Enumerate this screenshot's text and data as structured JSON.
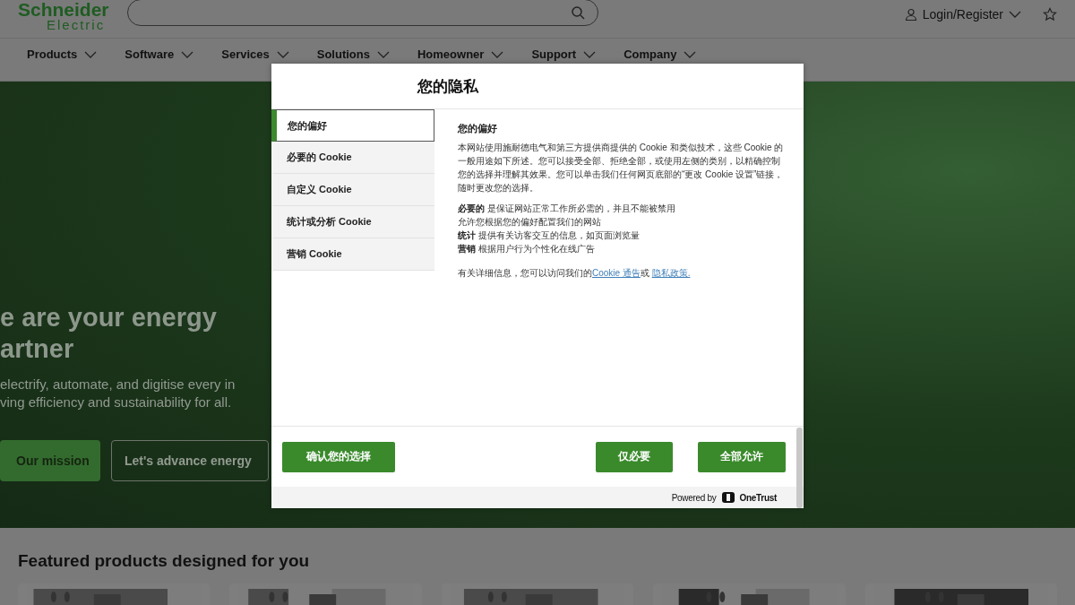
{
  "header": {
    "logo": {
      "line_1": "Schneider",
      "line_2": "Electric"
    },
    "login": "Login/Register"
  },
  "nav": [
    {
      "label": "Products"
    },
    {
      "label": "Software"
    },
    {
      "label": "Services"
    },
    {
      "label": "Solutions"
    },
    {
      "label": "Homeowner"
    },
    {
      "label": "Support"
    },
    {
      "label": "Company"
    }
  ],
  "hero": {
    "title_lines": [
      "e are your energy",
      "artner"
    ],
    "text_lines": [
      "electrify, automate, and digitise every in",
      "ving efficiency and sustainability for all."
    ],
    "buttons": [
      {
        "label": "Our mission",
        "kind": "primary"
      },
      {
        "label": "Let's advance energy",
        "kind": "outline"
      }
    ]
  },
  "featured": {
    "title": "Featured products designed for you"
  },
  "dialog": {
    "title": "您的隐私",
    "tabs": [
      {
        "label": "您的偏好",
        "selected": true
      },
      {
        "label": "必要的 Cookie",
        "selected": false
      },
      {
        "label": "自定义 Cookie",
        "selected": false
      },
      {
        "label": "统计或分析 Cookie",
        "selected": false
      },
      {
        "label": "营销 Cookie",
        "selected": false
      }
    ],
    "heading": "您的偏好",
    "paragraph": "本网站使用施耐德电气和第三方提供商提供的 Cookie 和类似技术，这些 Cookie 的一般用途如下所述。您可以接受全部、拒绝全部，或使用左侧的类别，以精确控制您的选择并理解其效果。您可以单击我们任何网页底部的“更改 Cookie 设置”链接，随时更改您的选择。",
    "lines": [
      "**必要的** 是保证网站正常工作所必需的，并且不能被禁用",
      "允许您根据您的偏好配置我们的网站",
      "**统计** 提供有关访客交互的信息，如页面浏览量",
      "**营销** 根据用户行为个性化在线广告"
    ],
    "more_info": {
      "text": "有关详细信息，您可以访问我们的",
      "link_1": "Cookie 通告",
      "between": "或",
      "link_2": "隐私政策."
    },
    "buttons": {
      "confirm": "确认您的选择",
      "necessary": "仅必要",
      "allow_all": "全部允许"
    },
    "powered_by": "Powered by",
    "brand": "OneTrust"
  }
}
